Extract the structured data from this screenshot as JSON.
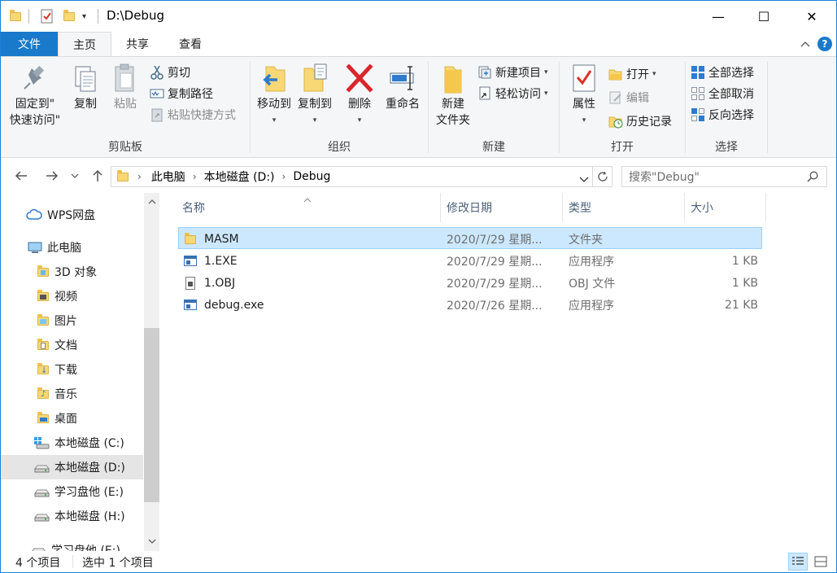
{
  "window": {
    "title": "D:\\Debug",
    "minimize_glyph": "—",
    "maximize_glyph": "☐",
    "close_glyph": "✕"
  },
  "tabs": {
    "file": "文件",
    "home": "主页",
    "share": "共享",
    "view": "查看"
  },
  "ribbon": {
    "clipboard": {
      "label": "剪贴板",
      "pin_line1": "固定到\"",
      "pin_line2": "快速访问\"",
      "copy": "复制",
      "paste": "粘贴",
      "cut": "剪切",
      "copy_path": "复制路径",
      "paste_shortcut": "粘贴快捷方式"
    },
    "organize": {
      "label": "组织",
      "move_to": "移动到",
      "copy_to": "复制到",
      "delete": "删除",
      "rename": "重命名"
    },
    "new": {
      "label": "新建",
      "new_folder_line1": "新建",
      "new_folder_line2": "文件夹",
      "new_item": "新建项目",
      "easy_access": "轻松访问"
    },
    "open": {
      "label": "打开",
      "properties": "属性",
      "open": "打开",
      "edit": "编辑",
      "history": "历史记录"
    },
    "select": {
      "label": "选择",
      "select_all": "全部选择",
      "select_none": "全部取消",
      "invert": "反向选择"
    }
  },
  "address": {
    "crumbs": [
      "此电脑",
      "本地磁盘 (D:)",
      "Debug"
    ],
    "search_placeholder": "搜索\"Debug\""
  },
  "nav": {
    "items": [
      {
        "label": "WPS网盘",
        "icon": "cloud-icon"
      },
      {
        "label": "此电脑",
        "icon": "computer-icon"
      },
      {
        "label": "3D 对象",
        "icon": "3d-objects-icon"
      },
      {
        "label": "视频",
        "icon": "videos-icon"
      },
      {
        "label": "图片",
        "icon": "pictures-icon"
      },
      {
        "label": "文档",
        "icon": "documents-icon"
      },
      {
        "label": "下载",
        "icon": "downloads-icon"
      },
      {
        "label": "音乐",
        "icon": "music-icon"
      },
      {
        "label": "桌面",
        "icon": "desktop-icon"
      },
      {
        "label": "本地磁盘 (C:)",
        "icon": "system-drive-icon"
      },
      {
        "label": "本地磁盘 (D:)",
        "icon": "drive-icon"
      },
      {
        "label": "学习盘他 (E:)",
        "icon": "drive-icon"
      },
      {
        "label": "本地磁盘 (H:)",
        "icon": "drive-icon"
      },
      {
        "label": "学习盘他 (E:)",
        "icon": "drive-icon"
      }
    ]
  },
  "columns": {
    "name": "名称",
    "modified": "修改日期",
    "type": "类型",
    "size": "大小"
  },
  "files": [
    {
      "name": "MASM",
      "modified": "2020/7/29 星期...",
      "type": "文件夹",
      "size": "",
      "icon": "folder-icon"
    },
    {
      "name": "1.EXE",
      "modified": "2020/7/29 星期...",
      "type": "应用程序",
      "size": "1 KB",
      "icon": "exe-icon"
    },
    {
      "name": "1.OBJ",
      "modified": "2020/7/29 星期...",
      "type": "OBJ 文件",
      "size": "1 KB",
      "icon": "obj-file-icon"
    },
    {
      "name": "debug.exe",
      "modified": "2020/7/26 星期...",
      "type": "应用程序",
      "size": "21 KB",
      "icon": "exe-icon"
    }
  ],
  "status": {
    "item_count": "4 个项目",
    "selected": "选中 1 个项目"
  },
  "colors": {
    "accent": "#1979ca",
    "selection": "#cce8ff",
    "folder": "#f8d775"
  }
}
